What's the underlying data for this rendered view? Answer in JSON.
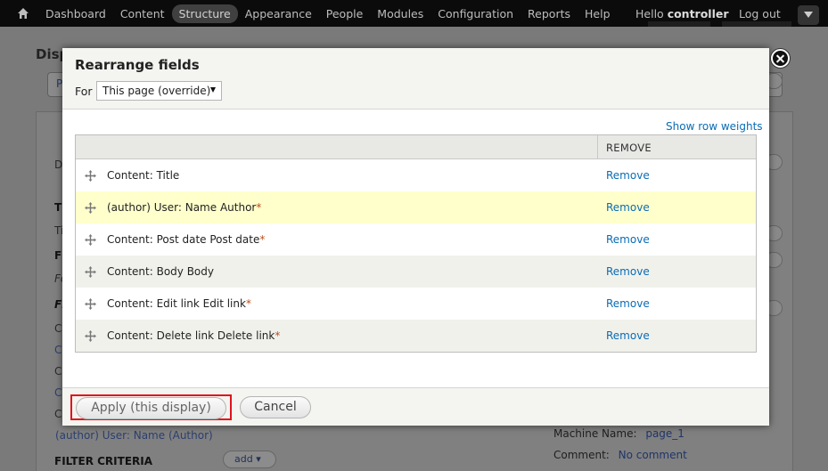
{
  "toolbar": {
    "menu": [
      "Dashboard",
      "Content",
      "Structure",
      "Appearance",
      "People",
      "Modules",
      "Configuration",
      "Reports",
      "Help"
    ],
    "hello": "Hello",
    "username": "controller",
    "logout": "Log out",
    "home_icon": "home-icon",
    "toggle_icon": "chevron-down-icon"
  },
  "background": {
    "page_title": "Disp",
    "tab_letter": "P",
    "texts": [
      "D",
      "Ti",
      "Ti",
      "FO",
      "Fo",
      "FI",
      "C",
      "C",
      "C",
      "C",
      "C"
    ],
    "author_link": "(author) User: Name (Author)",
    "filter_criteria": "FILTER CRITERIA",
    "add_label": "add",
    "machine_name_label": "Machine Name:",
    "machine_name_value": "page_1",
    "comment_label": "Comment:",
    "comment_value": "No comment"
  },
  "modal": {
    "title": "Rearrange fields",
    "for_label": "For",
    "select_value": "This page (override)",
    "show_row_weights": "Show row weights",
    "column_remove": "REMOVE",
    "rows": [
      {
        "label": "Content: Title",
        "star": "",
        "remove": "Remove"
      },
      {
        "label": "(author) User: Name Author",
        "star": "*",
        "remove": "Remove"
      },
      {
        "label": "Content: Post date Post date",
        "star": "*",
        "remove": "Remove"
      },
      {
        "label": "Content: Body Body",
        "star": "",
        "remove": "Remove"
      },
      {
        "label": "Content: Edit link Edit link",
        "star": "*",
        "remove": "Remove"
      },
      {
        "label": "Content: Delete link Delete link",
        "star": "*",
        "remove": "Remove"
      }
    ],
    "apply_label": "Apply (this display)",
    "cancel_label": "Cancel",
    "close_icon": "close-icon",
    "drag_icon": "drag-handle-icon"
  },
  "colors": {
    "link": "#0a6cb5",
    "highlight_row": "#ffffcc",
    "apply_outline": "#e0141b",
    "required_star": "#b8501f"
  }
}
